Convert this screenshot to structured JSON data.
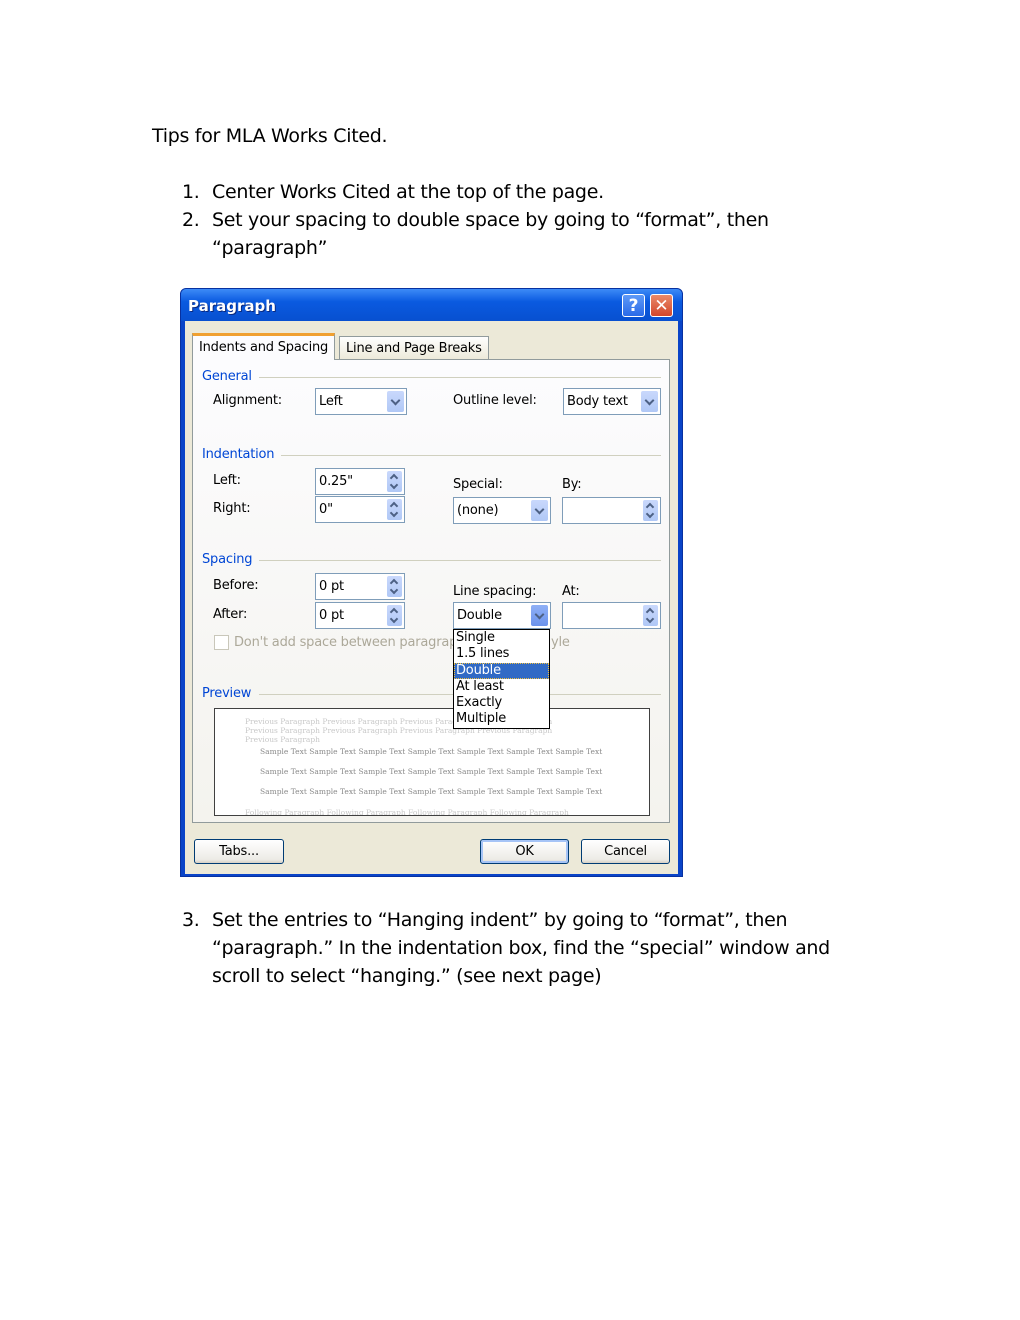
{
  "document": {
    "title": "Tips for MLA Works Cited.",
    "steps": [
      {
        "number": "1.",
        "lines": [
          "Center Works Cited at the top of the page."
        ]
      },
      {
        "number": "2.",
        "lines": [
          "Set your spacing to double space by going to “format”, then",
          "“paragraph”"
        ]
      },
      {
        "number": "3.",
        "lines": [
          "Set the entries to “Hanging indent” by going to “format”, then",
          "“paragraph.”  In the indentation box, find the “special” window and",
          "scroll to select “hanging.”  (see next page)"
        ]
      }
    ]
  },
  "dialog": {
    "title": "Paragraph",
    "help_icon": "?",
    "close_icon": "✕",
    "tabs": [
      {
        "label": "Indents and Spacing",
        "active": true
      },
      {
        "label": "Line and Page Breaks",
        "active": false
      }
    ],
    "general": {
      "heading": "General",
      "alignment_label": "Alignment:",
      "alignment_value": "Left",
      "outline_label": "Outline level:",
      "outline_value": "Body text"
    },
    "indentation": {
      "heading": "Indentation",
      "left_label": "Left:",
      "left_value": "0.25\"",
      "right_label": "Right:",
      "right_value": "0\"",
      "special_label": "Special:",
      "special_value": "(none)",
      "by_label": "By:",
      "by_value": ""
    },
    "spacing": {
      "heading": "Spacing",
      "before_label": "Before:",
      "before_value": "0 pt",
      "after_label": "After:",
      "after_value": "0 pt",
      "line_spacing_label": "Line spacing:",
      "line_spacing_value": "Double",
      "at_label": "At:",
      "at_value": "",
      "line_spacing_options": [
        "Single",
        "1.5 lines",
        "Double",
        "At least",
        "Exactly",
        "Multiple"
      ],
      "selected_option": "Double",
      "checkbox_label": "Don't add space between paragraph",
      "checkbox_tail": "yle",
      "checkbox_checked": false
    },
    "preview": {
      "heading": "Preview",
      "previous_text": "Previous Paragraph Previous Paragraph Previous Paragraph Previous Paragraph Previous Paragraph Previous Paragraph Previous Paragraph Previous Paragraph Previous Paragraph",
      "sample_text": "Sample Text Sample Text Sample Text Sample Text Sample Text Sample Text Sample Text",
      "following_text": "Following Paragraph Following Paragraph Following Paragraph Following Paragraph"
    },
    "buttons": {
      "tabs": "Tabs...",
      "ok": "OK",
      "cancel": "Cancel"
    }
  }
}
